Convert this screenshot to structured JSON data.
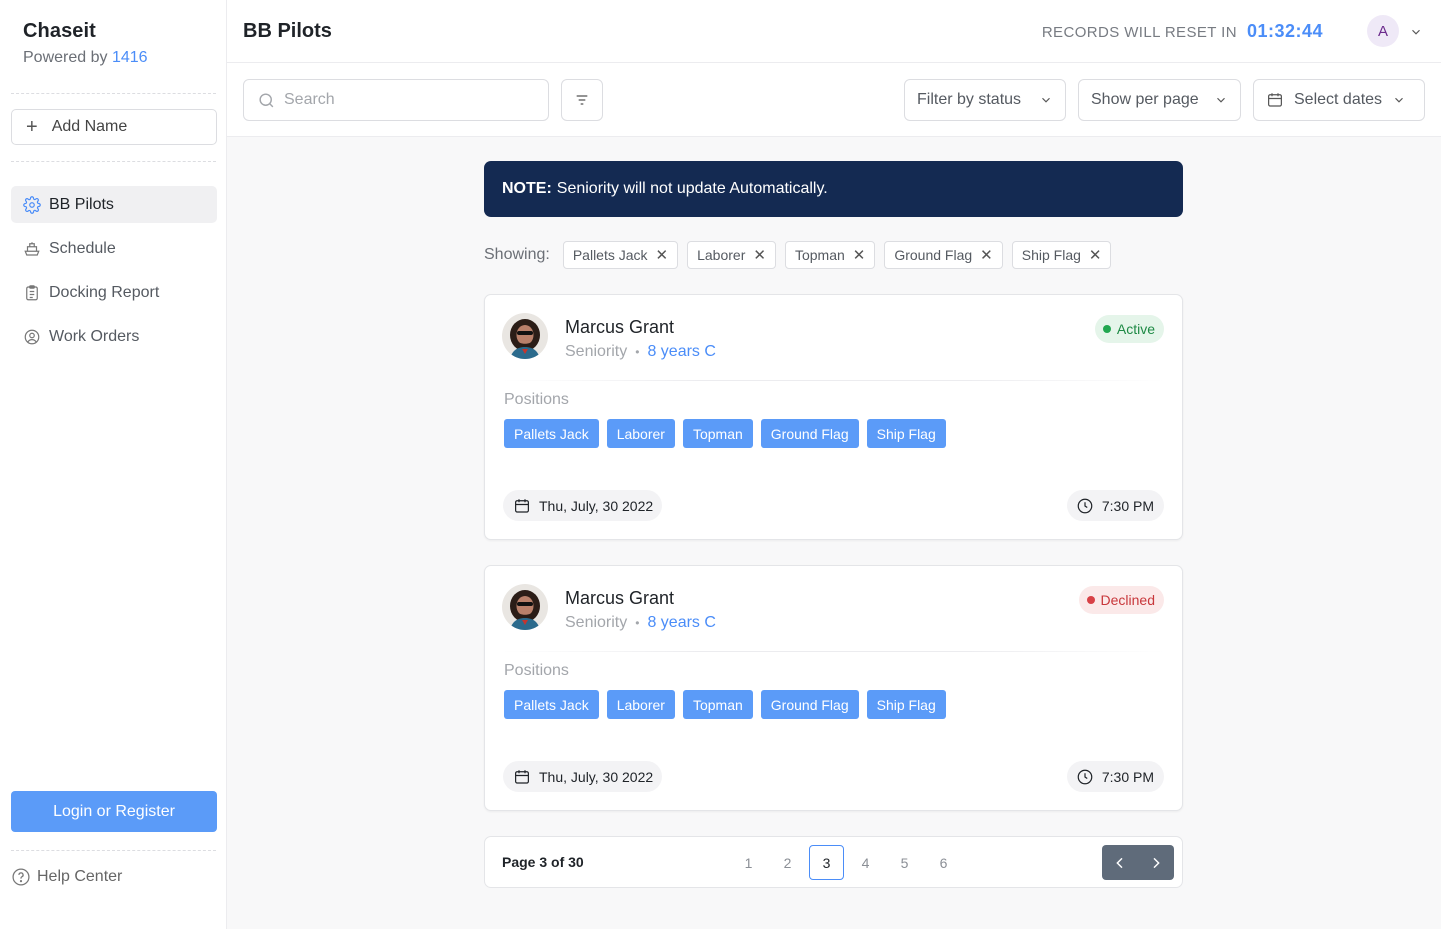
{
  "app": {
    "name": "Chaseit",
    "powered_prefix": "Powered by",
    "powered_number": "1416"
  },
  "sidebar": {
    "add_label": "Add Name",
    "items": [
      {
        "label": "BB Pilots",
        "icon": "gear-icon",
        "active": true
      },
      {
        "label": "Schedule",
        "icon": "ship-icon",
        "active": false
      },
      {
        "label": "Docking Report",
        "icon": "clipboard-icon",
        "active": false
      },
      {
        "label": "Work Orders",
        "icon": "user-circle-icon",
        "active": false
      }
    ],
    "login_label": "Login or Register",
    "help_label": "Help Center"
  },
  "header": {
    "title": "BB Pilots",
    "reset_label": "RECORDS WILL RESET IN",
    "reset_time": "01:32:44",
    "avatar_initial": "A"
  },
  "toolbar": {
    "search_placeholder": "Search",
    "filter_status": "Filter by status",
    "per_page": "Show per page",
    "dates": "Select dates"
  },
  "note": {
    "prefix": "NOTE:",
    "text": "Seniority will not update Automatically."
  },
  "showing": {
    "label": "Showing:",
    "chips": [
      "Pallets Jack",
      "Laborer",
      "Topman",
      "Ground Flag",
      "Ship Flag"
    ]
  },
  "cards": [
    {
      "name": "Marcus Grant",
      "seniority_label": "Seniority",
      "seniority_value": "8 years C",
      "status": "Active",
      "positions_label": "Positions",
      "positions": [
        "Pallets Jack",
        "Laborer",
        "Topman",
        "Ground Flag",
        "Ship Flag"
      ],
      "date": "Thu, July, 30 2022",
      "time": "7:30 PM"
    },
    {
      "name": "Marcus Grant",
      "seniority_label": "Seniority",
      "seniority_value": "8 years C",
      "status": "Declined",
      "positions_label": "Positions",
      "positions": [
        "Pallets Jack",
        "Laborer",
        "Topman",
        "Ground Flag",
        "Ship Flag"
      ],
      "date": "Thu, July, 30 2022",
      "time": "7:30 PM"
    }
  ],
  "pagination": {
    "info": "Page 3 of 30",
    "pages": [
      "1",
      "2",
      "3",
      "4",
      "5",
      "6"
    ],
    "current": "3"
  },
  "colors": {
    "accent": "#4b8df8",
    "tag_bg": "#5b9bf8",
    "note_bg": "#142a52",
    "active": "#22a750",
    "declined": "#d84146"
  }
}
